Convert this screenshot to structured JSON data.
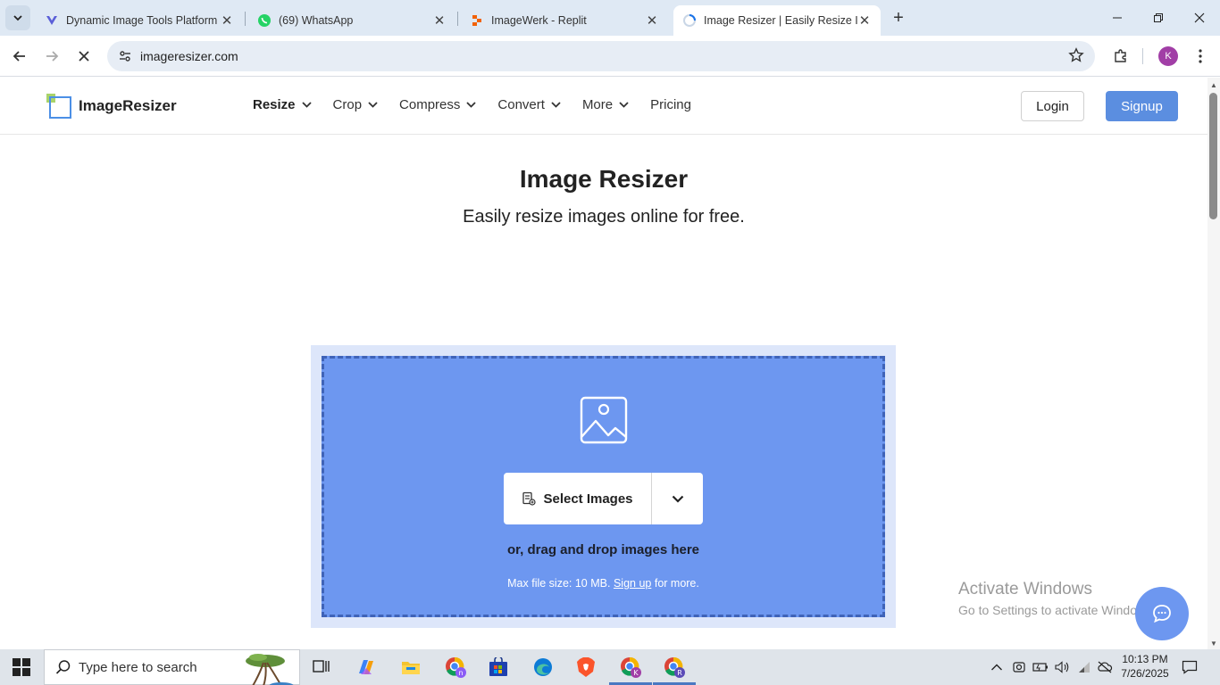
{
  "browser": {
    "tabs": [
      {
        "title": "Dynamic Image Tools Platform",
        "icon": "replit-agent-icon"
      },
      {
        "title": "(69) WhatsApp",
        "icon": "whatsapp-icon"
      },
      {
        "title": "ImageWerk - Replit",
        "icon": "replit-icon"
      },
      {
        "title": "Image Resizer | Easily Resize Im",
        "icon": "loading-spinner-icon"
      }
    ],
    "url": "imageresizer.com",
    "profile_initial": "K"
  },
  "site": {
    "logo_text": "ImageResizer",
    "nav": [
      {
        "label": "Resize",
        "has_dropdown": true
      },
      {
        "label": "Crop",
        "has_dropdown": true
      },
      {
        "label": "Compress",
        "has_dropdown": true
      },
      {
        "label": "Convert",
        "has_dropdown": true
      },
      {
        "label": "More",
        "has_dropdown": true
      },
      {
        "label": "Pricing",
        "has_dropdown": false
      }
    ],
    "login_label": "Login",
    "signup_label": "Signup"
  },
  "hero": {
    "title": "Image Resizer",
    "subtitle": "Easily resize images online for free."
  },
  "upload": {
    "select_label": "Select Images",
    "drag_text": "or, drag and drop images here",
    "max_prefix": "Max file size: 10 MB.",
    "signup_link": "Sign up",
    "max_suffix": "for more."
  },
  "watermark": {
    "line1": "Activate Windows",
    "line2": "Go to Settings to activate Windows."
  },
  "taskbar": {
    "search_placeholder": "Type here to search",
    "time": "10:13 PM",
    "date": "7/26/2025"
  },
  "colors": {
    "drop_zone": "#6d97f0",
    "drop_zone_border": "#3f63b8",
    "signup_button": "#5b8ee0",
    "profile_avatar": "#a13ea6"
  }
}
